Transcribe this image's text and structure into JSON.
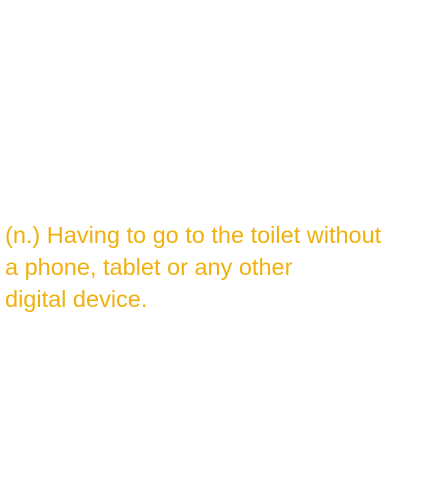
{
  "definition": {
    "lines": [
      "(n.) Having to go to the toilet without",
      "a phone, tablet or any other",
      "digital device."
    ]
  },
  "colors": {
    "text": "#f0b010",
    "background": "#ffffff"
  }
}
